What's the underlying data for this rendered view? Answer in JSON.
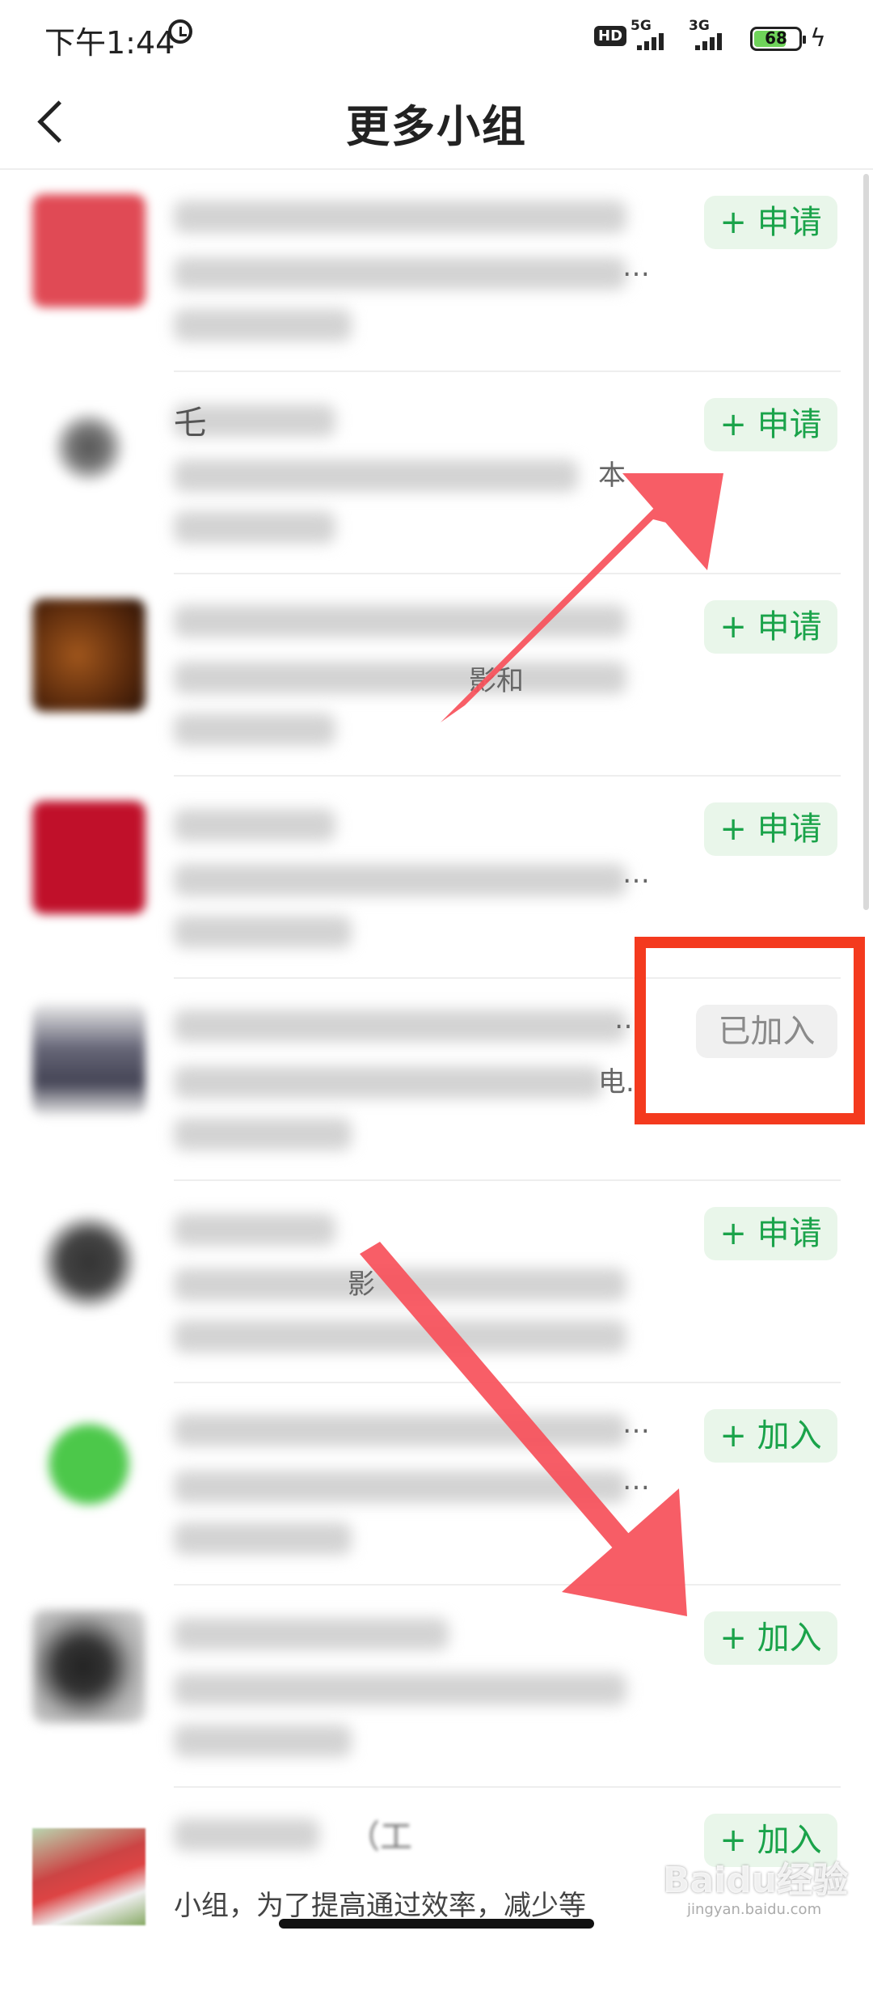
{
  "status_bar": {
    "time": "下午1:44",
    "hd": "HD",
    "signal1": "5G",
    "signal2": "3G",
    "battery": "68"
  },
  "header": {
    "title": "更多小组"
  },
  "items": [
    {
      "button": "+ 申请",
      "peek": "…",
      "peek2": "…"
    },
    {
      "button": "+ 申请",
      "peek": "乇",
      "peek2": "本"
    },
    {
      "button": "+ 申请",
      "peek": "影和",
      "peek2": ""
    },
    {
      "button": "+ 申请",
      "peek": "…",
      "peek2": ""
    },
    {
      "button": "已加入",
      "peek": "…",
      "peek2": "电."
    },
    {
      "button": "+ 申请",
      "peek": "影",
      "peek2": ""
    },
    {
      "button": "+ 加入",
      "peek": "…",
      "peek2": "…"
    },
    {
      "button": "+ 加入",
      "peek": "",
      "peek2": ""
    },
    {
      "button": "+ 加入",
      "peek": "（工",
      "peek2": "小组，为了提高通过效率，减少等"
    }
  ],
  "watermark": {
    "text": "Baidu经验",
    "url": "jingyan.baidu.com"
  },
  "colors": {
    "accent_green": "#1aa34a",
    "apply_bg": "#e9f6ea",
    "highlight_red": "#f43a1e",
    "arrow_red": "#f7505a"
  }
}
